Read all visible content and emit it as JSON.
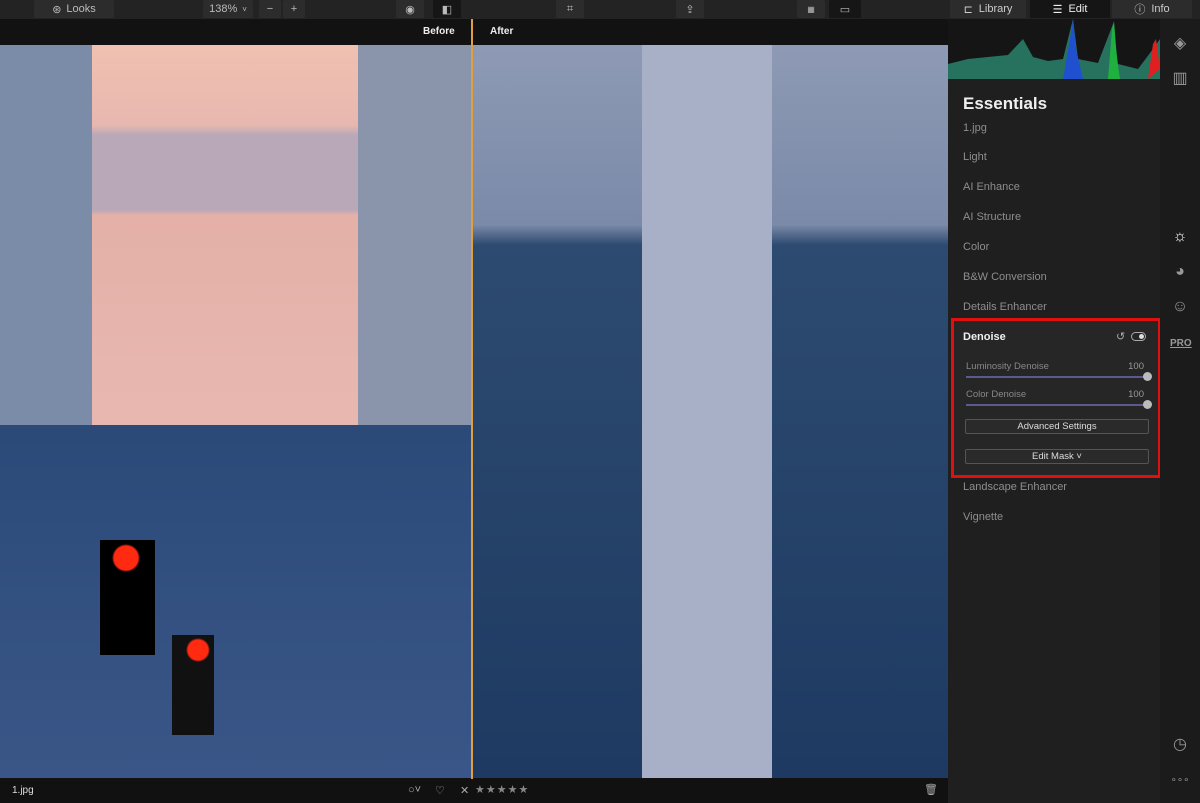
{
  "toolbar": {
    "looks": "Looks",
    "zoom": "138%",
    "zoom_out": "−",
    "zoom_in": "+",
    "tabs": [
      {
        "label": "Library",
        "icon": "library-icon"
      },
      {
        "label": "Edit",
        "icon": "sliders-icon",
        "active": true
      },
      {
        "label": "Info",
        "icon": "info-icon"
      }
    ]
  },
  "viewer": {
    "before": "Before",
    "after": "After"
  },
  "panel": {
    "title": "Essentials",
    "file": "1.jpg",
    "sections": [
      "Light",
      "AI Enhance",
      "AI Structure",
      "Color",
      "B&W Conversion",
      "Details Enhancer"
    ],
    "after_sections": [
      "Landscape Enhancer",
      "Vignette"
    ],
    "denoise": {
      "title": "Denoise",
      "sliders": [
        {
          "label": "Luminosity Denoise",
          "value": "100"
        },
        {
          "label": "Color Denoise",
          "value": "100"
        }
      ],
      "advanced": "Advanced Settings",
      "mask": "Edit Mask ˅",
      "highlight_color": "#e01010"
    }
  },
  "strip": {
    "pro": "PRO"
  },
  "bottom": {
    "filename": "1.jpg",
    "flag": "○˅",
    "heart": "♡",
    "reject": "✕",
    "stars": "★★★★★",
    "rating": 0
  }
}
